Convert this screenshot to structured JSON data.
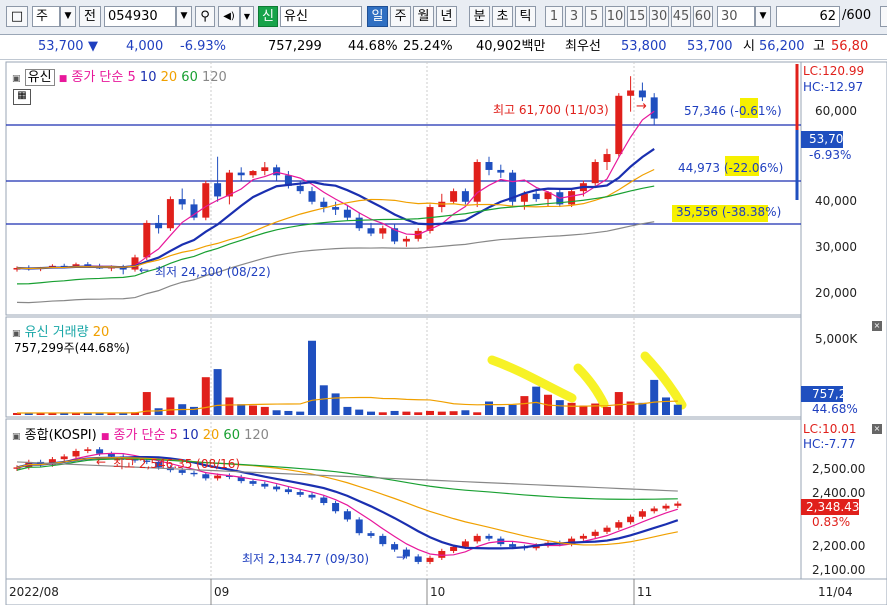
{
  "toolbar": {
    "market_select": "주",
    "prev_label": "전",
    "code": "054930",
    "signal_badge": "신",
    "stock_name": "유신",
    "periods": [
      "일",
      "주",
      "월",
      "년",
      "분",
      "초",
      "틱"
    ],
    "active_period": "일",
    "intervals": [
      "1",
      "3",
      "5",
      "10",
      "15",
      "30",
      "45",
      "60"
    ],
    "interval_value": "30",
    "count_value": "62",
    "count_total": "/600"
  },
  "quote": {
    "price": "53,700",
    "down_arrow": "▼",
    "change": "4,000",
    "change_pct": "-6.93%",
    "volume": "757,299",
    "vol_ratio": "44.68%",
    "turnover": "25.24%",
    "amount": "40,902백만",
    "best_ask_label": "최우선",
    "best_ask": "53,800",
    "best_bid": "53,700",
    "open_label": "시",
    "open": "56,200",
    "high_label": "고",
    "high": "56,80"
  },
  "price_panel": {
    "name": "유신",
    "ma_label": "종가 단순",
    "ma_periods": [
      "5",
      "10",
      "20",
      "60",
      "120"
    ],
    "ma_colors": [
      "#e8189b",
      "#1a2fb0",
      "#f0a000",
      "#19a032",
      "#888888"
    ],
    "lc": "LC:120.99",
    "hc": "HC:-12.97",
    "ticks": [
      "60,000",
      "50,000",
      "40,000",
      "30,000",
      "20,000"
    ],
    "current_price": "53,700",
    "current_pct": "-6.93%",
    "high_note": "최고 61,700 (11/03)",
    "low_note": "최저 24,300 (08/22)",
    "hline1_value": "57,346",
    "hline1_pct": "-0.61%",
    "hline2_value": "44,973",
    "hline2_pct": "-22.06%",
    "hline3_value": "35,556",
    "hline3_pct": "-38.38%"
  },
  "volume_panel": {
    "name": "유신 거래량",
    "ma_period": "20",
    "current": "757,299주(44.68%)",
    "tick_top": "5,000K",
    "last_value": "757,299",
    "last_pct": "44.68%"
  },
  "index_panel": {
    "name": "종합(KOSPI)",
    "ma_label": "종가 단순",
    "ma_periods": [
      "5",
      "10",
      "20",
      "60",
      "120"
    ],
    "lc": "LC:10.01",
    "hc": "HC:-7.77",
    "ticks": [
      "2,500.00",
      "2,400.00",
      "2,300.00",
      "2,200.00",
      "2,100.00"
    ],
    "current": "2,348.43",
    "current_pct": "0.83%",
    "high_note": "최고 2,546.35 (08/16)",
    "low_note": "최저 2,134.77 (09/30)"
  },
  "x_axis": {
    "labels": [
      "2022/08",
      "09",
      "10",
      "11"
    ],
    "right_label": "11/04"
  },
  "chart_data": [
    {
      "type": "candlestick",
      "title": "유신",
      "unit": "KRW",
      "ylim": [
        17000,
        64000
      ],
      "x_month_labels": [
        "2022/08",
        "09",
        "10",
        "11"
      ],
      "candles_ohlc": [
        [
          25200,
          25800,
          24800,
          25500
        ],
        [
          25500,
          26000,
          25000,
          25300
        ],
        [
          25300,
          25700,
          24900,
          25600
        ],
        [
          25600,
          26200,
          25400,
          25900
        ],
        [
          25900,
          26300,
          25500,
          25700
        ],
        [
          25700,
          26500,
          25600,
          26200
        ],
        [
          26200,
          26600,
          25800,
          25900
        ],
        [
          25900,
          26300,
          25300,
          25400
        ],
        [
          25400,
          26000,
          24900,
          25800
        ],
        [
          25800,
          26100,
          24300,
          25200
        ],
        [
          25200,
          28000,
          24800,
          27500
        ],
        [
          27500,
          34500,
          27000,
          34000
        ],
        [
          34000,
          35500,
          32000,
          33000
        ],
        [
          33000,
          39000,
          32500,
          38500
        ],
        [
          38500,
          40500,
          36500,
          37500
        ],
        [
          37500,
          38500,
          34500,
          35000
        ],
        [
          35000,
          42000,
          34500,
          41500
        ],
        [
          41500,
          46500,
          38000,
          39000
        ],
        [
          39000,
          44000,
          37500,
          43500
        ],
        [
          43500,
          44500,
          42000,
          43000
        ],
        [
          43000,
          44000,
          42500,
          43800
        ],
        [
          43800,
          45500,
          43000,
          44500
        ],
        [
          44500,
          45000,
          42000,
          43000
        ],
        [
          43000,
          43800,
          40500,
          41000
        ],
        [
          41000,
          42000,
          39500,
          40000
        ],
        [
          40000,
          40800,
          37500,
          38000
        ],
        [
          38000,
          38800,
          36000,
          37000
        ],
        [
          37000,
          38000,
          35500,
          36500
        ],
        [
          36500,
          37200,
          34500,
          35000
        ],
        [
          35000,
          36000,
          32500,
          33000
        ],
        [
          33000,
          34000,
          31500,
          32000
        ],
        [
          32000,
          33500,
          31000,
          33000
        ],
        [
          33000,
          33800,
          30000,
          30500
        ],
        [
          30500,
          31500,
          29500,
          31000
        ],
        [
          31000,
          33000,
          30500,
          32500
        ],
        [
          32500,
          37500,
          32000,
          37000
        ],
        [
          37000,
          39500,
          36000,
          38000
        ],
        [
          38000,
          40500,
          37500,
          40000
        ],
        [
          40000,
          40500,
          37500,
          38000
        ],
        [
          38000,
          46000,
          37000,
          45500
        ],
        [
          45500,
          46500,
          43000,
          44000
        ],
        [
          44000,
          45000,
          42500,
          43500
        ],
        [
          43500,
          44000,
          37000,
          38000
        ],
        [
          38000,
          40000,
          36500,
          39500
        ],
        [
          39500,
          40500,
          38000,
          38500
        ],
        [
          38500,
          40000,
          37000,
          39800
        ],
        [
          39800,
          40500,
          37000,
          37500
        ],
        [
          37500,
          40500,
          37000,
          40000
        ],
        [
          40000,
          42000,
          39000,
          41500
        ],
        [
          41500,
          46000,
          41000,
          45500
        ],
        [
          45500,
          48000,
          44000,
          47000
        ],
        [
          47000,
          58500,
          46500,
          58000
        ],
        [
          58000,
          61700,
          55000,
          59000
        ],
        [
          59000,
          60500,
          57000,
          57700
        ],
        [
          57700,
          58500,
          52500,
          53700
        ]
      ]
    },
    {
      "type": "bar",
      "title": "유신 거래량",
      "unit": "K shares",
      "ylim": [
        0,
        6000
      ],
      "values": [
        150,
        150,
        160,
        150,
        150,
        160,
        170,
        150,
        160,
        180,
        200,
        1700,
        500,
        1300,
        800,
        600,
        2800,
        3400,
        1300,
        800,
        700,
        600,
        350,
        300,
        250,
        5500,
        2200,
        1600,
        600,
        400,
        250,
        200,
        300,
        250,
        200,
        300,
        250,
        280,
        350,
        200,
        1000,
        600,
        750,
        1400,
        2100,
        1500,
        1100,
        900,
        700,
        850,
        600,
        1700,
        1000,
        900,
        2600,
        1300,
        760
      ]
    },
    {
      "type": "candlestick",
      "title": "종합(KOSPI)",
      "ylim": [
        2080,
        2580
      ],
      "close_series": [
        2480,
        2500,
        2490,
        2510,
        2520,
        2540,
        2546,
        2530,
        2520,
        2515,
        2505,
        2500,
        2480,
        2470,
        2460,
        2455,
        2440,
        2450,
        2445,
        2430,
        2420,
        2410,
        2400,
        2390,
        2380,
        2370,
        2350,
        2320,
        2290,
        2240,
        2230,
        2200,
        2180,
        2155,
        2135,
        2150,
        2175,
        2190,
        2210,
        2230,
        2220,
        2200,
        2190,
        2185,
        2195,
        2205,
        2200,
        2220,
        2230,
        2245,
        2260,
        2280,
        2300,
        2320,
        2330,
        2340,
        2348
      ]
    }
  ]
}
